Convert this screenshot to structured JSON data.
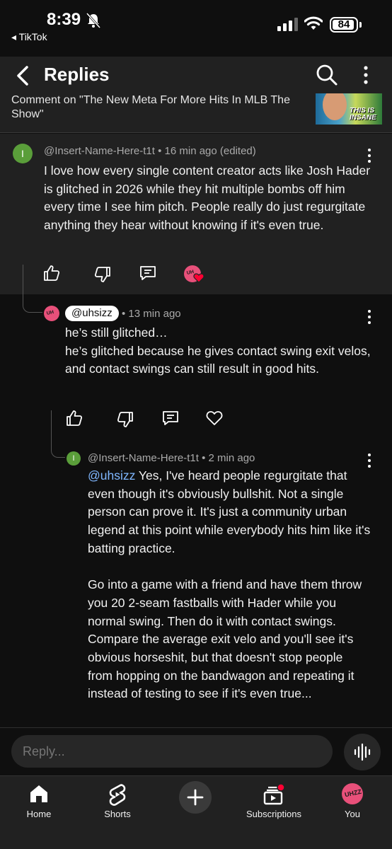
{
  "status_bar": {
    "time": "8:39",
    "back_app": "◂ TikTok",
    "battery": "84"
  },
  "header": {
    "title": "Replies"
  },
  "context": {
    "text": "Comment on \"The New Meta For More Hits In MLB The Show\"",
    "thumbnail_text": "THIS IS INSANE"
  },
  "main_comment": {
    "avatar_letter": "I",
    "meta": "@Insert-Name-Here-t1t • 16 min ago (edited)",
    "body": "I love how every single content creator acts like Josh Hader is glitched in 2026 while they hit multiple bombs off him every time I see him pitch. People really do just regurgitate anything they hear without knowing if it's even true."
  },
  "reply_1": {
    "handle": "@uhsizz",
    "time": "• 13 min ago",
    "line1": "he’s still glitched…",
    "line2": "he’s glitched because he gives contact swing exit velos, and contact swings can still result in good hits."
  },
  "reply_2": {
    "avatar_letter": "I",
    "meta": "@Insert-Name-Here-t1t • 2 min ago",
    "mention": "@uhsizz",
    "para1": " Yes, I've heard people regurgitate that even though it's obviously bullshit. Not a single person can prove it. It's just a community urban legend at this point while everybody hits him like it's batting practice.",
    "para2": "Go into a game with a friend and have them throw you 20 2-seam fastballs with Hader while you normal swing. Then do it with contact swings. Compare the average exit velo and you'll see it's obvious horseshit, but that doesn't stop people from hopping on the bandwagon and repeating it instead of testing to see if it's even true..."
  },
  "reply_input": {
    "placeholder": "Reply..."
  },
  "bottom_nav": {
    "items": [
      {
        "label": "Home",
        "icon": "home-icon"
      },
      {
        "label": "Shorts",
        "icon": "shorts-icon"
      },
      {
        "label": "Subscriptions",
        "icon": "subscriptions-icon"
      },
      {
        "label": "You",
        "icon": "avatar"
      }
    ]
  },
  "colors": {
    "background": "#0f0f0f",
    "surface": "#212121",
    "link": "#7fb7ff",
    "avatar_green": "#5a9e3a",
    "avatar_pink": "#e8507a",
    "notification_red": "#ff0033"
  }
}
